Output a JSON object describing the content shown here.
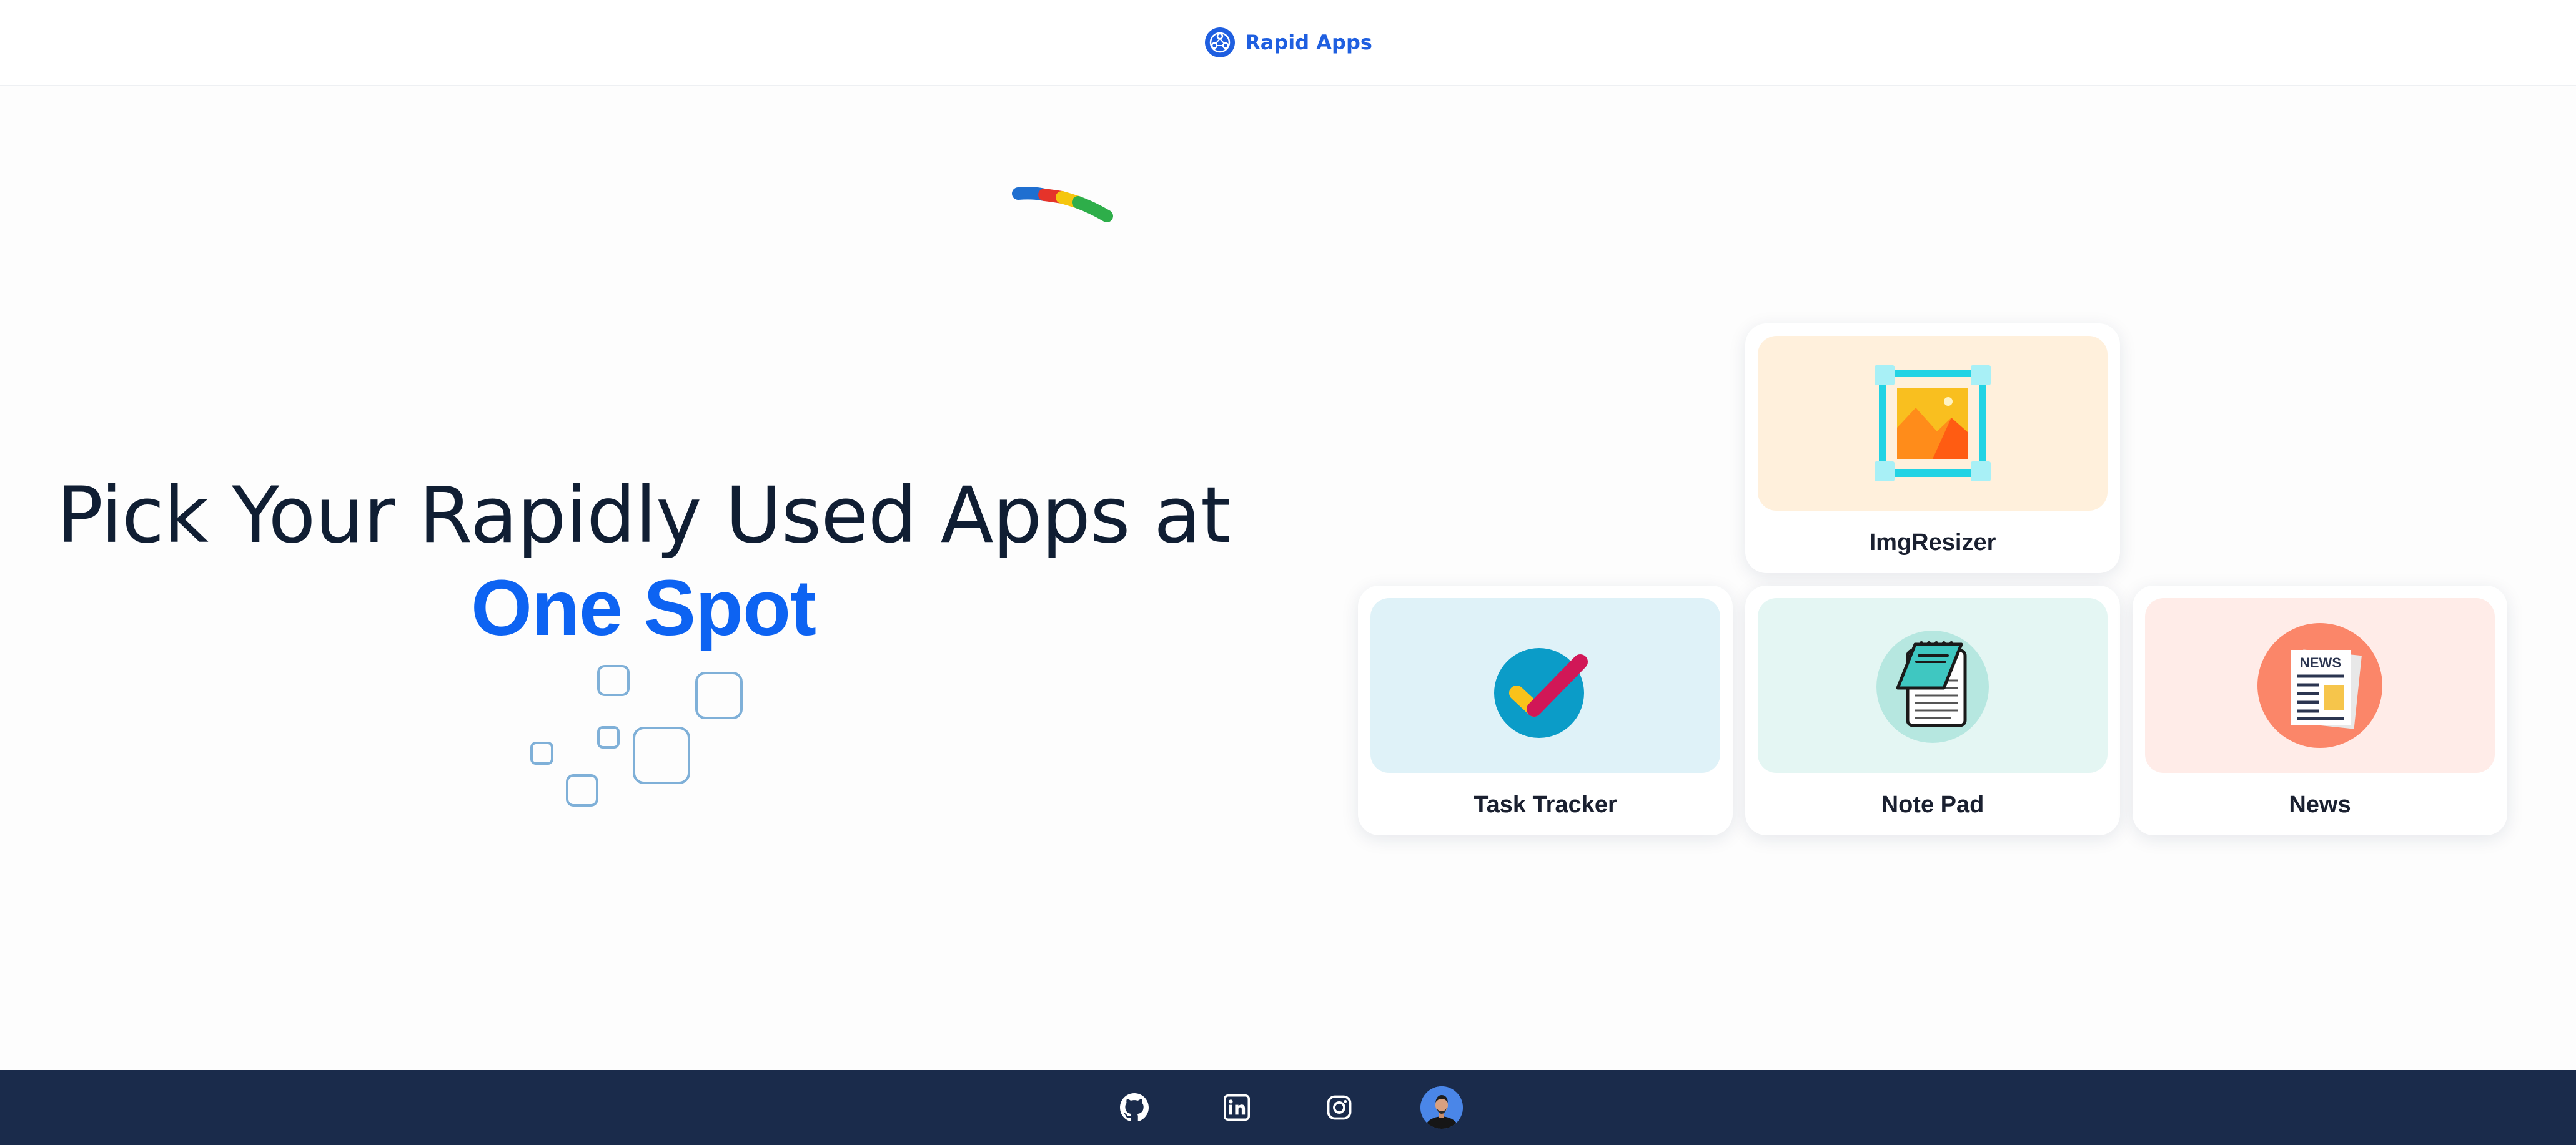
{
  "header": {
    "brand_name": "Rapid Apps",
    "logo_icon": "app-logo-icon"
  },
  "hero": {
    "title_line1": "Pick Your Rapidly Used Apps at",
    "title_accent": "One Spot",
    "accent_color": "#0d63f2",
    "title_color": "#101e33"
  },
  "apps": [
    {
      "label": "ImgResizer",
      "icon": "image-resize-icon",
      "background": "#fff0dc"
    },
    {
      "label": "Task Tracker",
      "icon": "task-check-icon",
      "background": "#dff2f8"
    },
    {
      "label": "Note Pad",
      "icon": "notepad-icon",
      "background": "#e4f6f3"
    },
    {
      "label": "News",
      "icon": "newspaper-icon",
      "background": "#ffece8",
      "icon_text": "NEWS"
    }
  ],
  "footer": {
    "background": "#1a2b4b",
    "links": [
      {
        "icon": "github-icon"
      },
      {
        "icon": "linkedin-icon"
      },
      {
        "icon": "instagram-icon"
      },
      {
        "icon": "profile-avatar"
      }
    ]
  }
}
